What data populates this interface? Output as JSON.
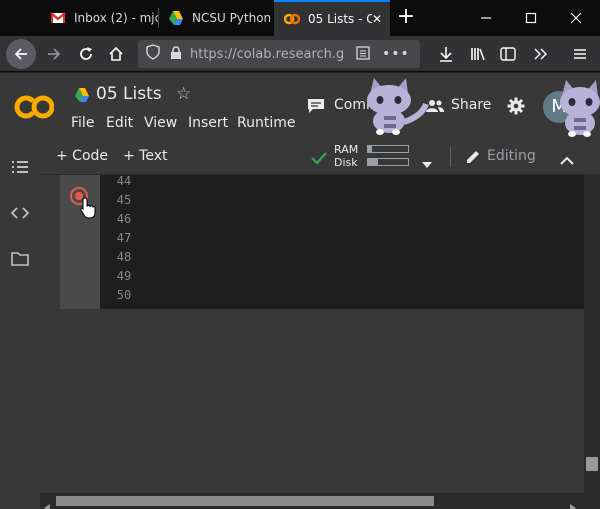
{
  "browser": {
    "tabs": [
      {
        "label": "Inbox (2) - mjc",
        "icon": "gmail-icon"
      },
      {
        "label": "NCSU Python",
        "icon": "google-drive-icon"
      },
      {
        "label": "05 Lists - C",
        "icon": "colab-icon",
        "active": true
      }
    ],
    "new_tab": "+",
    "url": "https://colab.research.g"
  },
  "colab": {
    "logo": "CO",
    "title": "05 Lists",
    "menu": [
      "File",
      "Edit",
      "View",
      "Insert",
      "Runtime"
    ],
    "comment_label": "Comment",
    "share_label": "Share",
    "avatar_letter": "M"
  },
  "toolbar": {
    "add_code": "+ Code",
    "add_text": "+ Text",
    "ram_label": "RAM",
    "disk_label": "Disk",
    "ram_usage": 0.1,
    "disk_usage": 0.25,
    "editing_label": "Editing"
  },
  "cell": {
    "line_numbers": [
      "44",
      "45",
      "46",
      "47",
      "48",
      "49",
      "50"
    ]
  },
  "colors": {
    "colab_orange": "#f9ab00",
    "run_red": "#e6584a",
    "connected_green": "#34a853"
  }
}
